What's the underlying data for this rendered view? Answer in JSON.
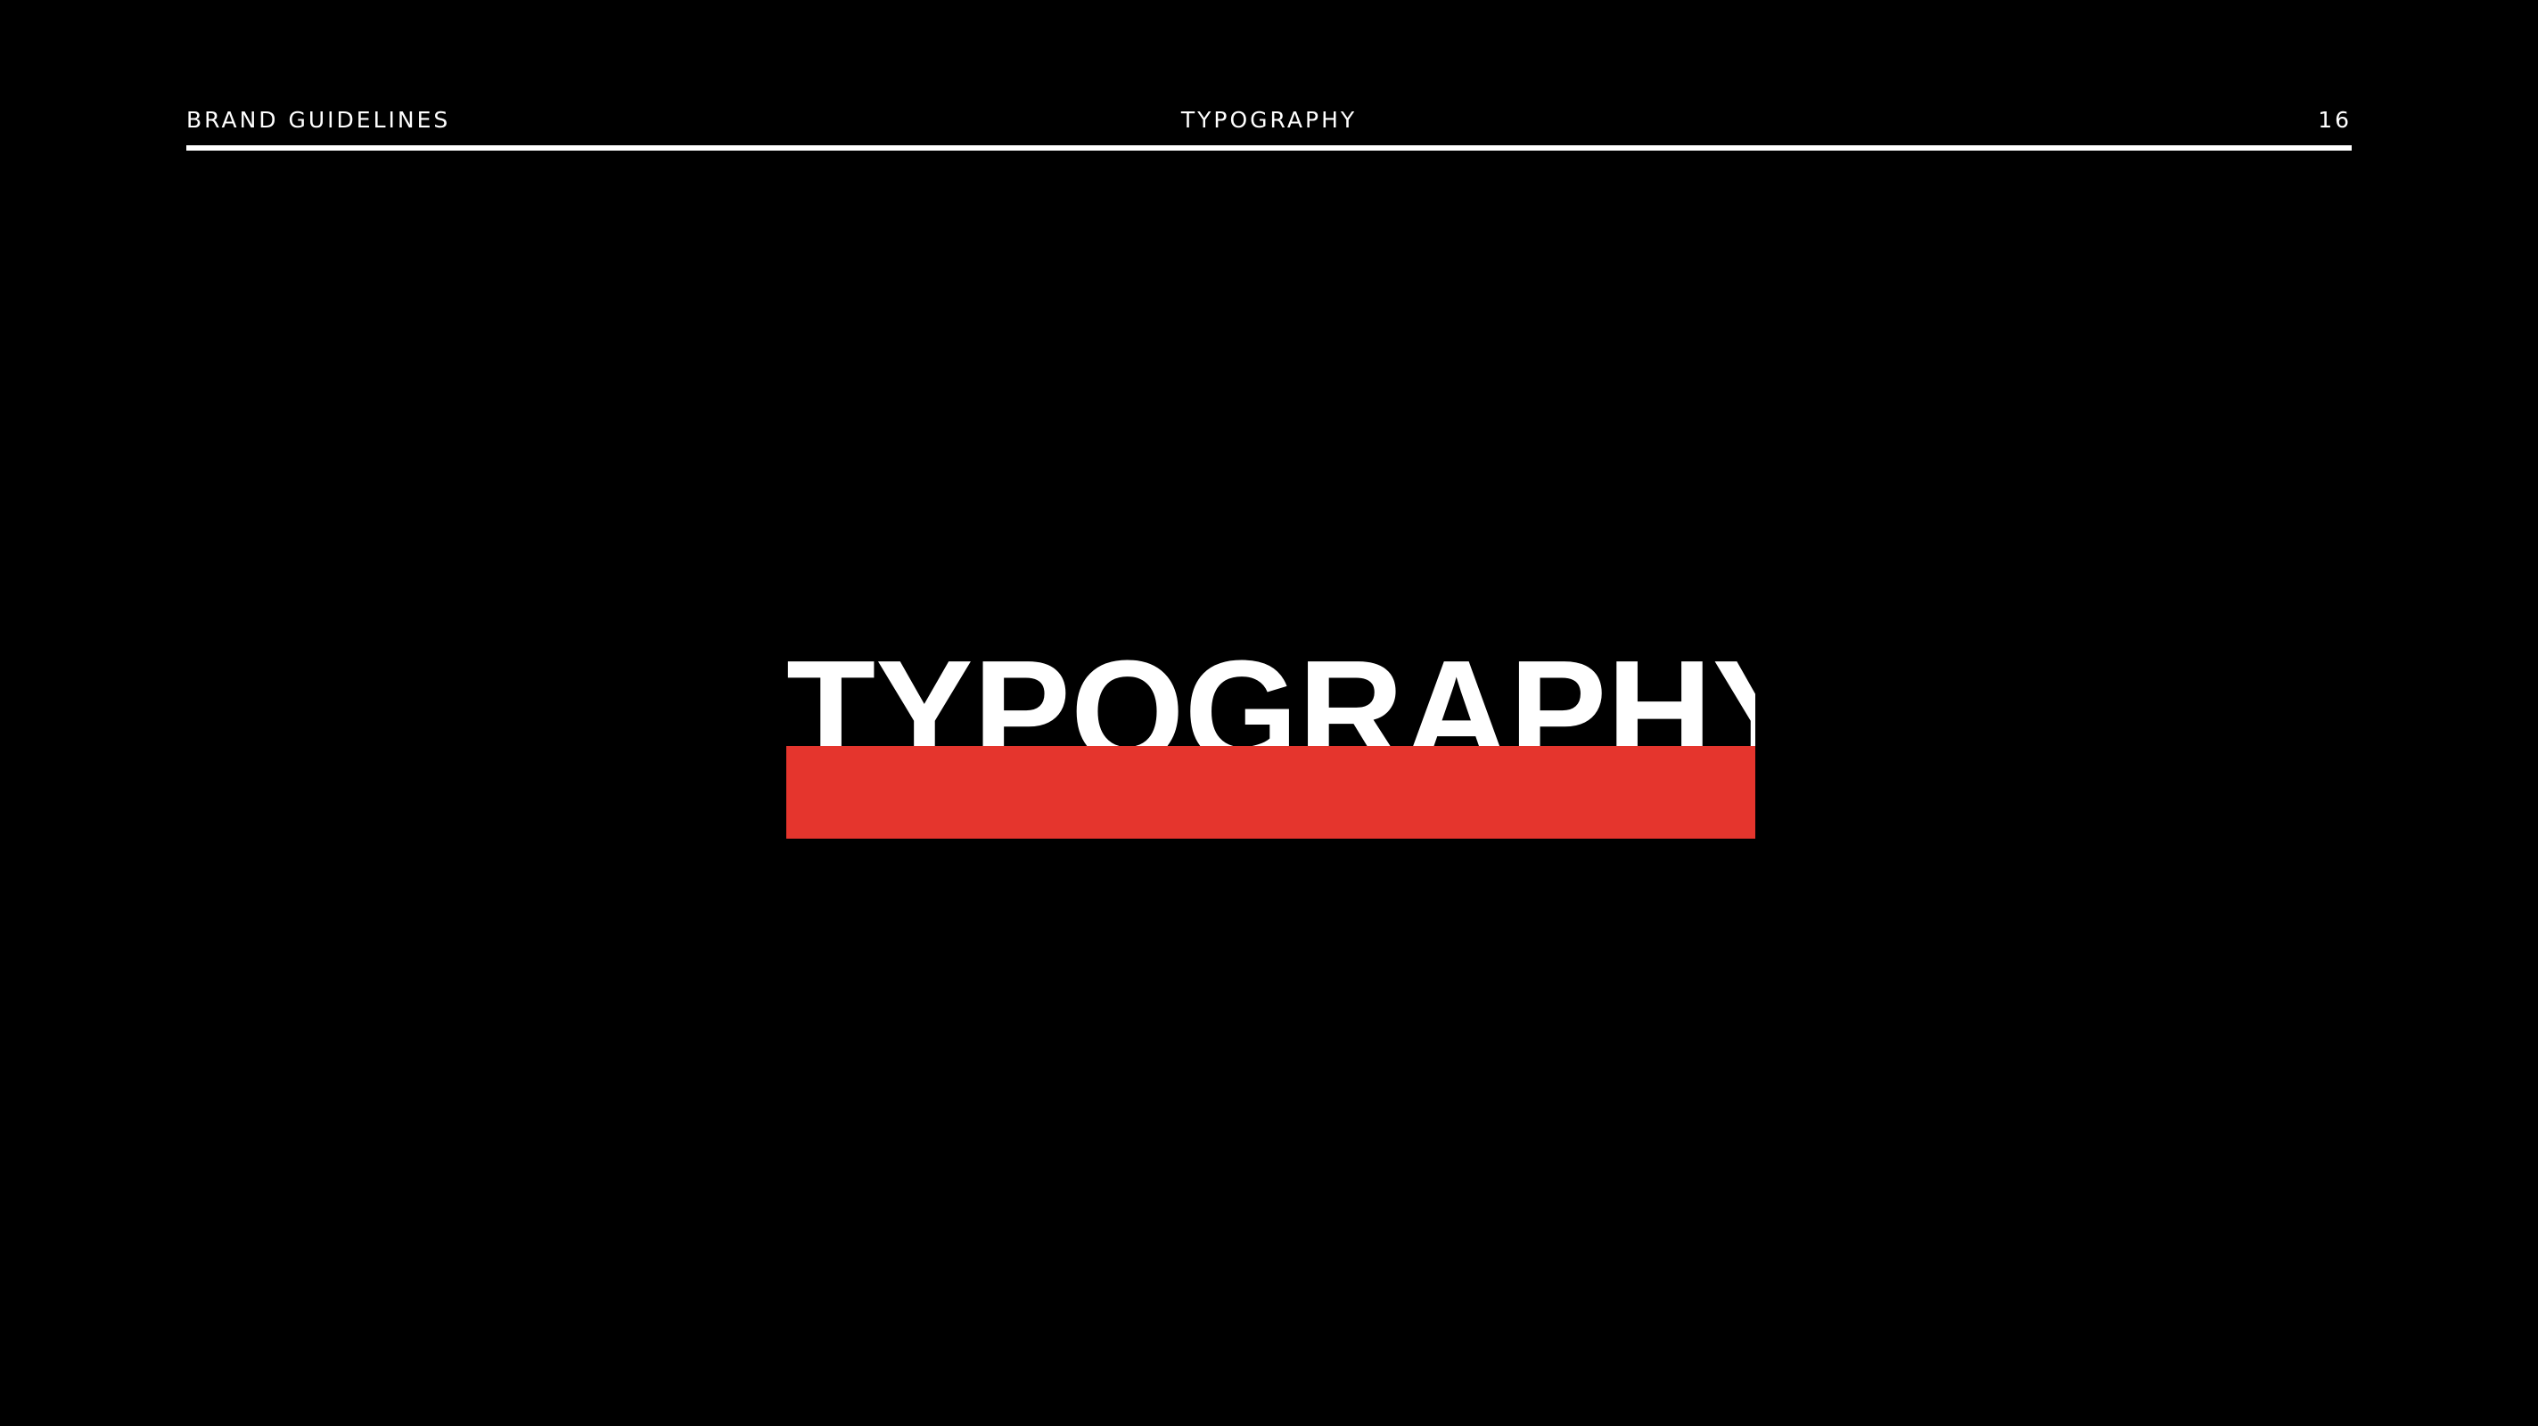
{
  "header": {
    "left_label": "BRAND GUIDELINES",
    "center_label": "TYPOGRAPHY",
    "page_number": "16"
  },
  "hero": {
    "title": "TYPOGRAPHY"
  },
  "colors": {
    "background": "#000000",
    "text": "#ffffff",
    "accent": "#e5352d"
  }
}
